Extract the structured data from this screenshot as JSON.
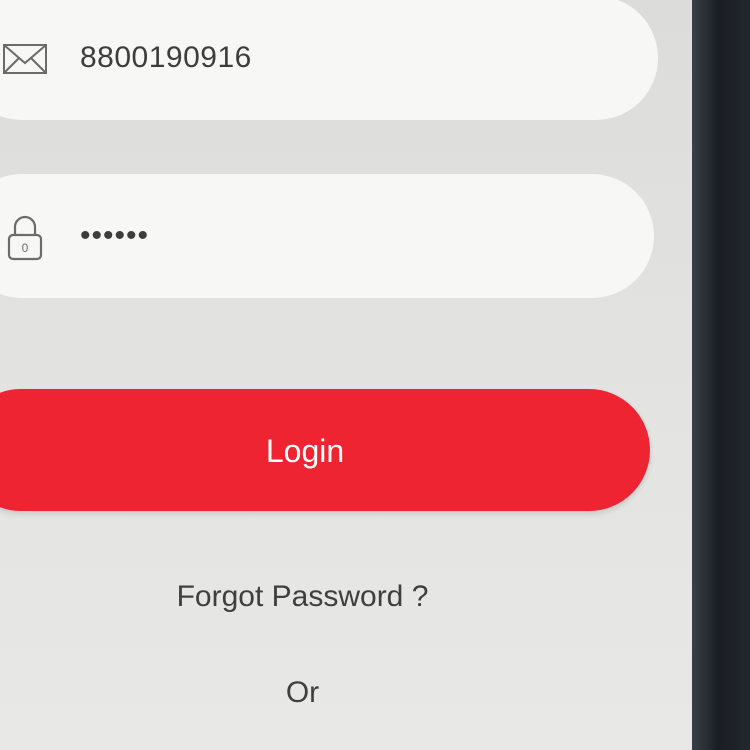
{
  "login_form": {
    "phone_field": {
      "icon": "envelope-icon",
      "value": "8800190916"
    },
    "password_field": {
      "icon": "lock-icon",
      "lock_digit": "0",
      "value": "••••••"
    },
    "login_button": {
      "label": "Login",
      "color": "#ee2432"
    },
    "forgot_password_link": "Forgot Password ?",
    "separator": "Or"
  },
  "colors": {
    "screen_background": "#e2e2e0",
    "field_background": "#f7f7f6",
    "primary_red": "#ee2432",
    "text": "#3d3d3d"
  }
}
